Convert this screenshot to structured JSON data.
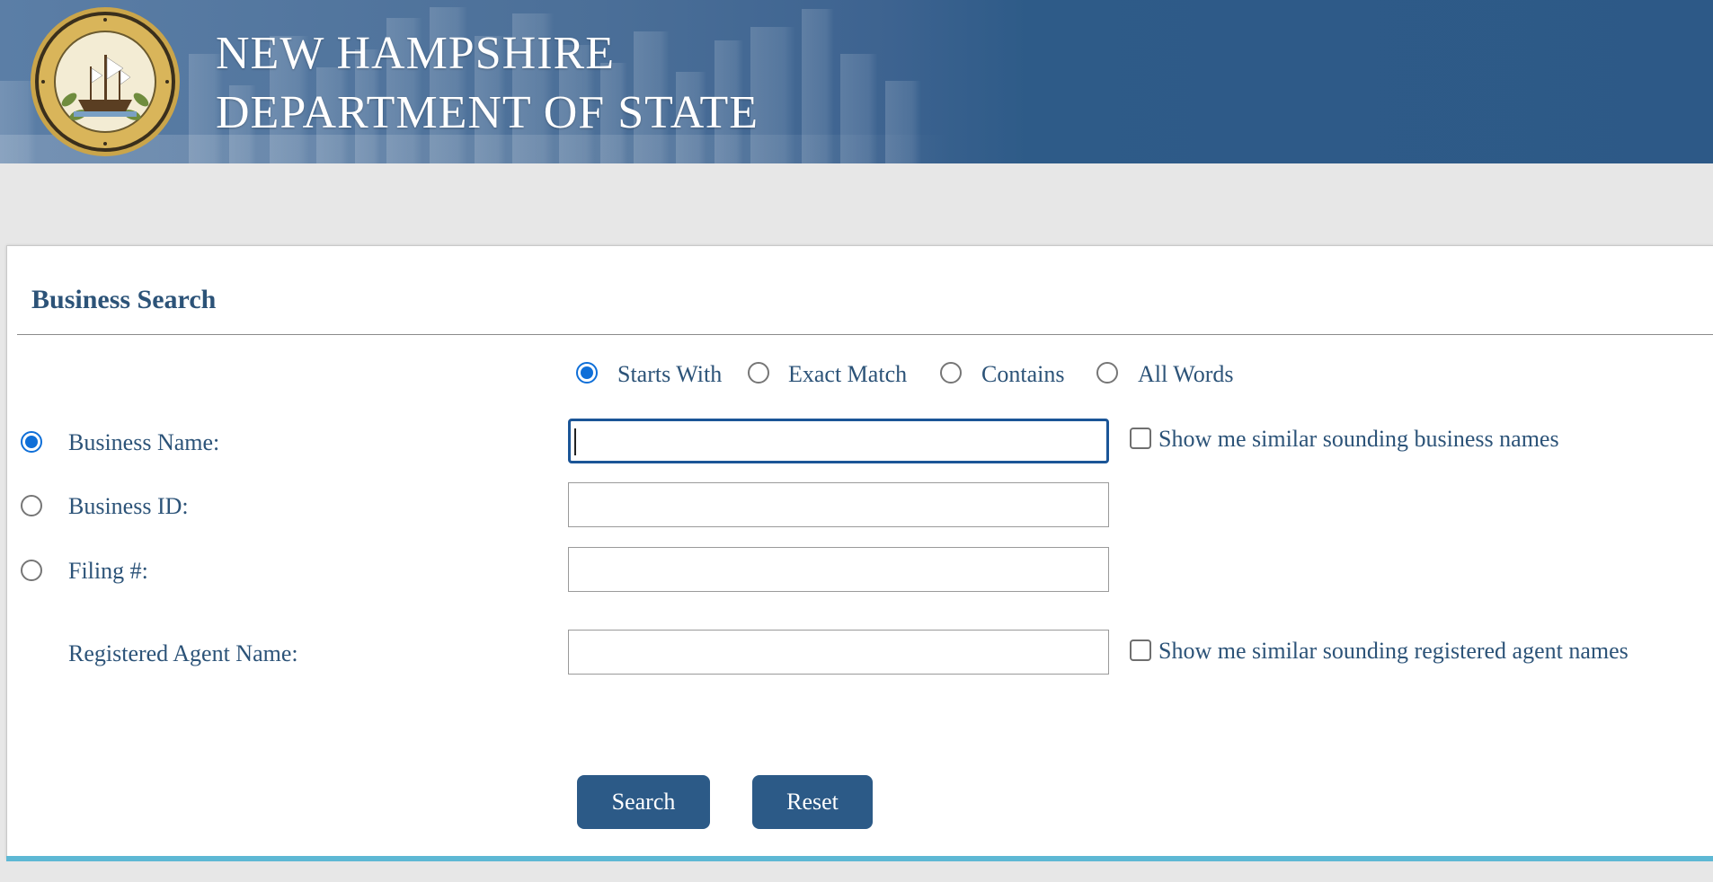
{
  "header": {
    "title_line1": "NEW HAMPSHIRE",
    "title_line2": "DEPARTMENT OF STATE",
    "seal_icon": "state-seal-icon"
  },
  "search": {
    "section_title": "Business Search",
    "match_options": [
      {
        "label": "Starts With",
        "selected": true
      },
      {
        "label": "Exact Match",
        "selected": false
      },
      {
        "label": "Contains",
        "selected": false
      },
      {
        "label": "All Words",
        "selected": false
      }
    ],
    "fields": {
      "business_name": {
        "label": "Business Name:",
        "value": "",
        "selected": true
      },
      "business_id": {
        "label": "Business ID:",
        "value": "",
        "selected": false
      },
      "filing_number": {
        "label": "Filing #:",
        "value": "",
        "selected": false
      },
      "registered_agent": {
        "label": "Registered Agent Name:",
        "value": ""
      }
    },
    "similar_business_label": "Show me similar sounding business names",
    "similar_agent_label": "Show me similar sounding registered agent names",
    "search_button": "Search",
    "reset_button": "Reset"
  },
  "colors": {
    "brand_blue": "#2c5a87",
    "label_blue": "#2c5378",
    "radio_selected": "#0f6fd8",
    "accent_line": "#5db8d4"
  }
}
